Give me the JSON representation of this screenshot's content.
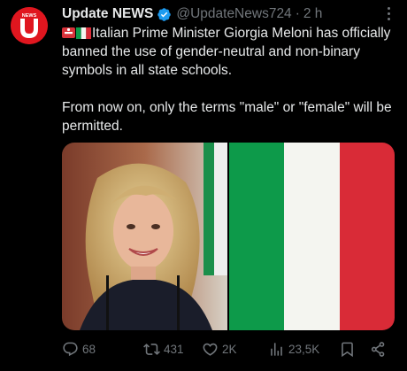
{
  "post": {
    "avatar": {
      "label": "NEWS",
      "letter": "U",
      "color": "#e0161f"
    },
    "display_name": "Update NEWS",
    "handle": "@UpdateNews724",
    "separator": "·",
    "time": "2 h",
    "verified_icon": "verified-badge-icon",
    "more_icon": "more-options-icon",
    "text_line_1": "Italian Prime Minister Giorgia Meloni has officially banned the use of gender-neutral and non-binary symbols in all state schools.",
    "text_line_2": "From now on, only the terms \"male\" or \"female\" will be permitted.",
    "emojis": [
      "no-entry-sign-icon",
      "italy-flag-icon"
    ]
  },
  "media": {
    "images": [
      "portrait-photo",
      "italian-flag-photo"
    ],
    "flag_colors": [
      "#0d9a4a",
      "#f4f5f0",
      "#d92b37"
    ]
  },
  "actions": {
    "reply_count": "68",
    "retweet_count": "431",
    "like_count": "2K",
    "views_count": "23,5K",
    "icons": [
      "reply-icon",
      "retweet-icon",
      "like-icon",
      "views-icon",
      "bookmark-icon",
      "share-icon"
    ]
  },
  "colors": {
    "background": "#000000",
    "text": "#e7e9ea",
    "muted": "#71767b",
    "verified": "#1d9bf0"
  }
}
